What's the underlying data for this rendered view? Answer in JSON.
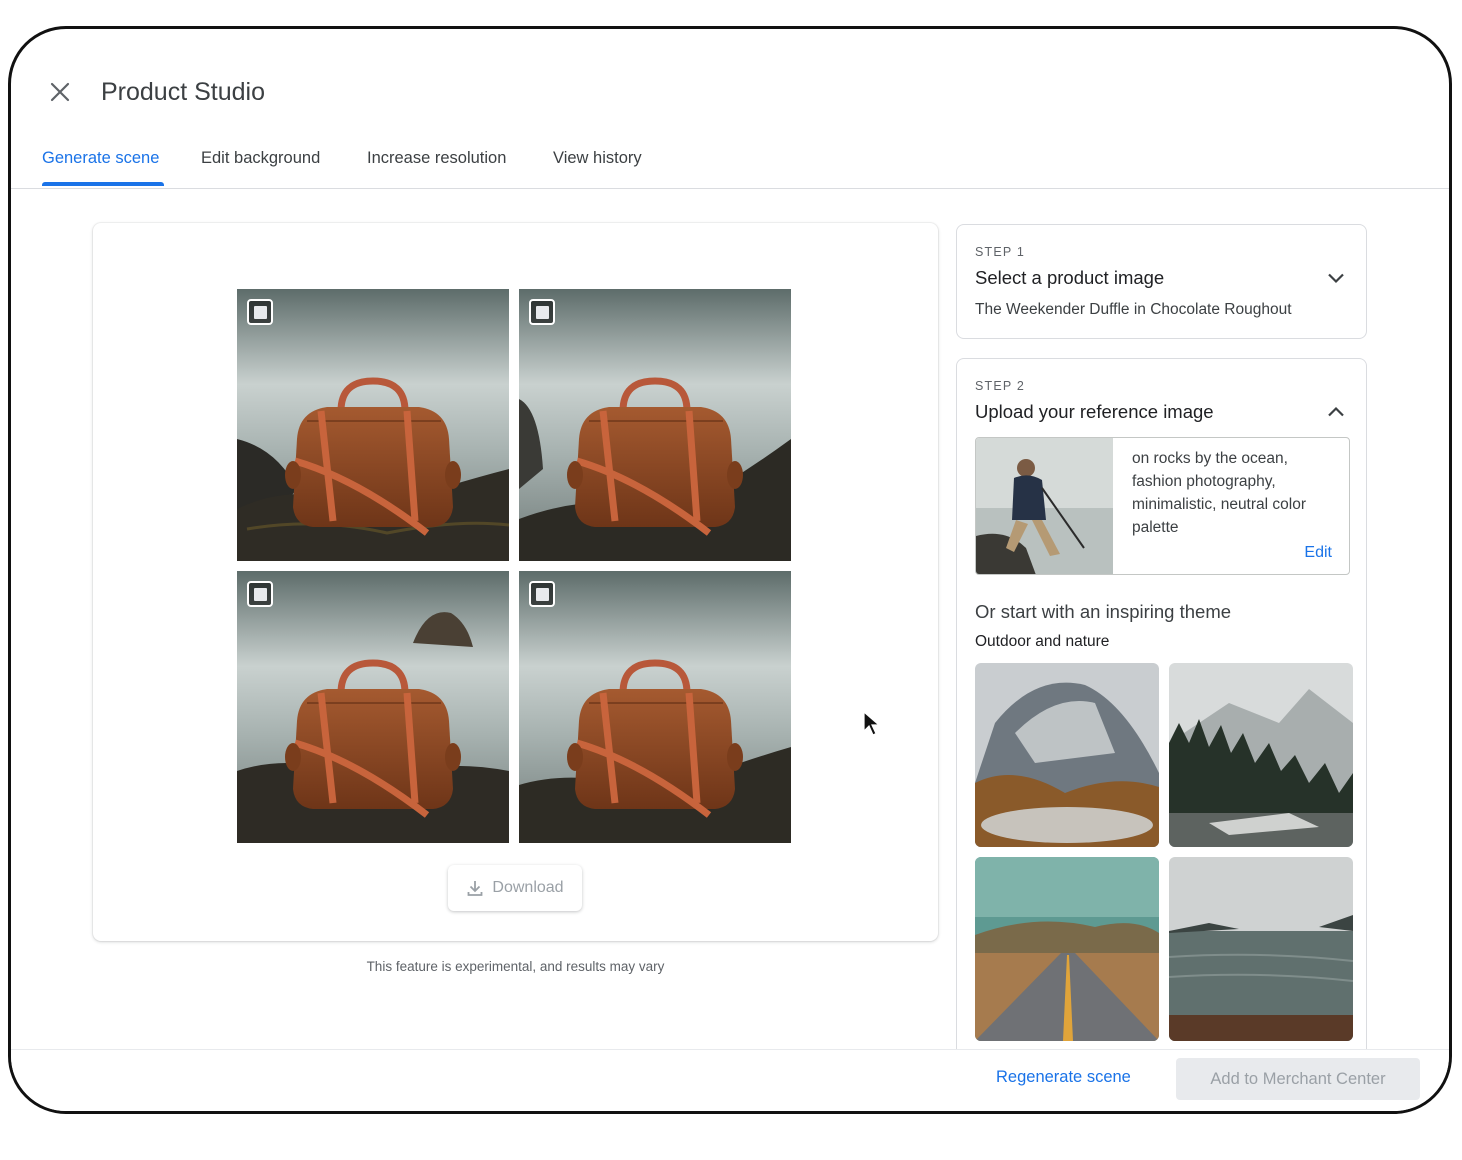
{
  "app": {
    "title": "Product Studio"
  },
  "tabs": [
    {
      "label": "Generate scene",
      "active": true
    },
    {
      "label": "Edit background",
      "active": false
    },
    {
      "label": "Increase resolution",
      "active": false
    },
    {
      "label": "View history",
      "active": false
    }
  ],
  "results": {
    "images": [
      {
        "subject": "brown leather duffle bag on rocks by the ocean",
        "selected": false
      },
      {
        "subject": "brown leather duffle bag on rocks by the ocean",
        "selected": false
      },
      {
        "subject": "brown leather duffle bag on rocks by the ocean",
        "selected": false
      },
      {
        "subject": "brown leather duffle bag on rocks by the ocean",
        "selected": false
      }
    ],
    "download_label": "Download",
    "disclaimer": "This feature is experimental, and results may vary"
  },
  "step1": {
    "label": "STEP 1",
    "title": "Select a product image",
    "product": "The Weekender Duffle in Chocolate Roughout",
    "expanded": false
  },
  "step2": {
    "label": "STEP 2",
    "title": "Upload your reference image",
    "prompt": "on rocks by the ocean, fashion photography, minimalistic, neutral color palette",
    "edit_label": "Edit",
    "expanded": true,
    "theme_heading": "Or start with an inspiring theme",
    "theme_category": "Outdoor and nature"
  },
  "footer": {
    "regenerate_label": "Regenerate scene",
    "add_label": "Add to Merchant Center"
  },
  "colors": {
    "accent": "#1a73e8",
    "bag": "#8b4a26",
    "strap": "#c8643c"
  }
}
